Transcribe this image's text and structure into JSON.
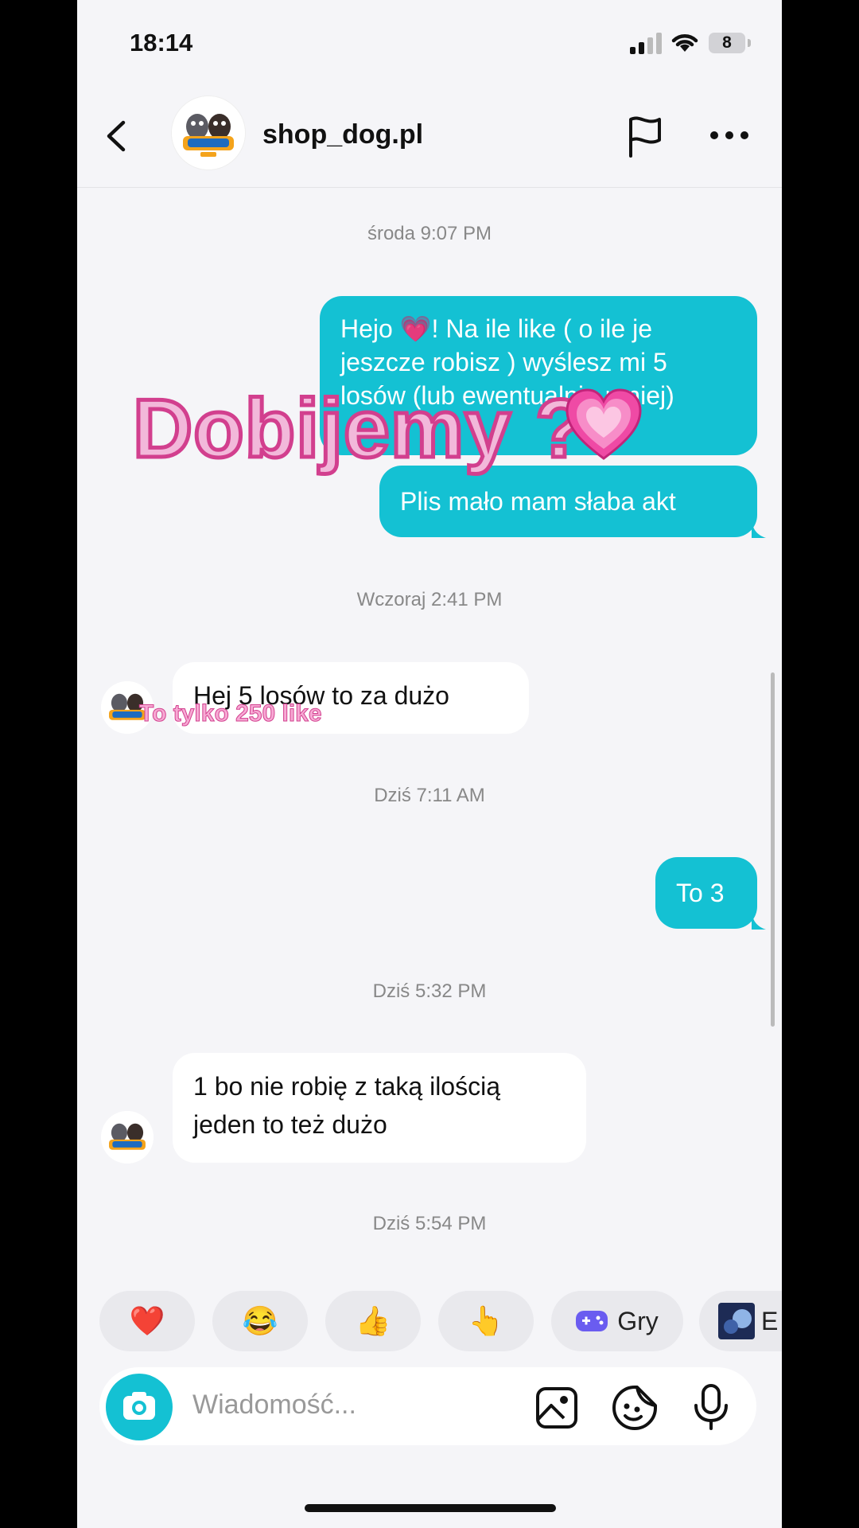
{
  "status_bar": {
    "time": "18:14",
    "battery": "8"
  },
  "header": {
    "shop_name": "shop_dog.pl"
  },
  "messages": [
    {
      "type": "timestamp",
      "text": "środa 9:07 PM"
    },
    {
      "type": "outgoing",
      "text": "Hejo 💗! Na ile like ( o ile je jeszcze robisz ) wyślesz mi 5 losów (lub ewentualnie mniej)"
    },
    {
      "type": "outgoing",
      "text": "Plis mało mam słaba akt"
    },
    {
      "type": "timestamp",
      "text": "Wczoraj 2:41 PM"
    },
    {
      "type": "incoming",
      "text": "Hej 5 losów to za dużo"
    },
    {
      "type": "timestamp",
      "text": "Dziś 7:11 AM"
    },
    {
      "type": "outgoing",
      "text": "To 3"
    },
    {
      "type": "timestamp",
      "text": "Dziś 5:32 PM"
    },
    {
      "type": "incoming",
      "line1": "1 bo nie robię z taką ilością",
      "line2": "jeden to też dużo"
    },
    {
      "type": "timestamp",
      "text": "Dziś 5:54 PM"
    }
  ],
  "reactions": [
    {
      "emoji": "❤️",
      "icon": "heart-icon"
    },
    {
      "emoji": "😂",
      "icon": "laugh-icon"
    },
    {
      "emoji": "👍",
      "icon": "thumbs-up-icon"
    },
    {
      "emoji": "👆",
      "icon": "pointing-icon"
    },
    {
      "label": "Gry",
      "icon": "gamepad-icon"
    },
    {
      "label": "E",
      "icon": "effect-thumbnail"
    }
  ],
  "composer": {
    "placeholder": "Wiadomość..."
  },
  "overlay": {
    "title": "Dobijemy ?",
    "heart": "💗",
    "subtitle": "To tylko 250 like"
  },
  "colors": {
    "accent": "#14c1d3",
    "background": "#f5f5f8",
    "overlay_pink": "#f2b8da",
    "overlay_stroke": "#d23f8e"
  }
}
